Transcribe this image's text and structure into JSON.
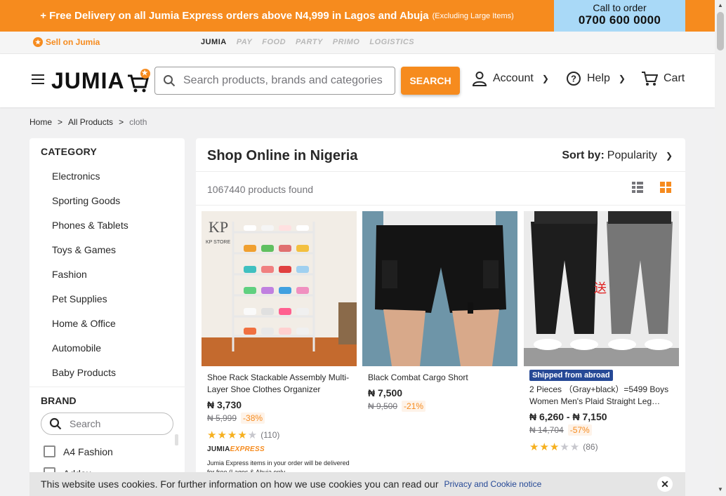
{
  "banner": {
    "promo": "+ Free Delivery on all Jumia Express orders above N4,999 in Lagos and Abuja",
    "promo_small": "(Excluding Large Items)",
    "call_label": "Call to order",
    "call_number": "0700 600 0000"
  },
  "strip": {
    "sell_label": "Sell on Jumia",
    "services": [
      "JUMIA",
      "PAY",
      "FOOD",
      "PARTY",
      "PRIMO",
      "LOGISTICS"
    ]
  },
  "header": {
    "logo": "JUMIA",
    "search_placeholder": "Search products, brands and categories",
    "search_button": "SEARCH",
    "account": "Account",
    "help": "Help",
    "cart": "Cart"
  },
  "breadcrumb": {
    "home": "Home",
    "all": "All Products",
    "current": "cloth",
    "sep": ">"
  },
  "sidebar": {
    "category_title": "CATEGORY",
    "categories": [
      "Electronics",
      "Sporting Goods",
      "Phones & Tablets",
      "Toys & Games",
      "Fashion",
      "Pet Supplies",
      "Home & Office",
      "Automobile",
      "Baby Products"
    ],
    "brand_title": "BRAND",
    "brand_search_placeholder": "Search",
    "brands": [
      "A4 Fashion",
      "Addax"
    ]
  },
  "main": {
    "title": "Shop Online in Nigeria",
    "sort_label": "Sort by:",
    "sort_value": "Popularity",
    "found": "1067440 products found"
  },
  "products": [
    {
      "name": "Shoe Rack Stackable Assembly Multi-Layer Shoe Clothes Organizer",
      "price": "₦ 3,730",
      "old_price": "₦ 5,999",
      "discount": "-38%",
      "stars": "★★★★",
      "stars_off": "★",
      "rating_value": 4,
      "reviews": "(110)",
      "express_brand": "JUMIA",
      "express_word": "EXPRESS",
      "express_note": "Jumia Express items in your order will be delivered for free (Lagos & Abuja only"
    },
    {
      "name": "Black Combat Cargo Short",
      "price": "₦ 7,500",
      "old_price": "₦ 9,500",
      "discount": "-21%"
    },
    {
      "badge": "Shipped from abroad",
      "name": "2 Pieces （Gray+black）=5499 Boys Women Men's Plaid Straight Leg…",
      "price": "₦ 6,260 - ₦ 7,150",
      "old_price": "₦ 14,704",
      "discount": "-57%",
      "stars": "★★★",
      "stars_off": "★★",
      "rating_value": 3,
      "reviews": "(86)"
    }
  ],
  "cookie": {
    "text": "This website uses cookies. For further information on how we use cookies you can read our",
    "link": "Privacy and Cookie notice",
    "close": "✕"
  },
  "colors": {
    "accent": "#f68b1e",
    "call_bg": "#a9d9f7",
    "badge_blue": "#264996",
    "star": "#f6b01e"
  }
}
